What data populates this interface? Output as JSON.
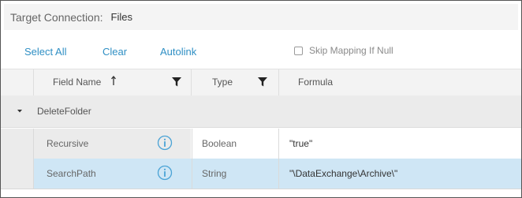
{
  "header": {
    "label": "Target Connection:",
    "value": "Files"
  },
  "toolbar": {
    "select_all": "Select All",
    "clear": "Clear",
    "autolink": "Autolink",
    "skip_mapping_label": "Skip Mapping If Null",
    "skip_mapping_checked": false
  },
  "columns": {
    "field_name": "Field Name",
    "type": "Type",
    "formula": "Formula"
  },
  "group": {
    "label": "DeleteFolder",
    "expanded": true
  },
  "rows": [
    {
      "field": "Recursive",
      "type": "Boolean",
      "formula": "\"true\"",
      "selected": false
    },
    {
      "field": "SearchPath",
      "type": "String",
      "formula": "\"\\DataExchange\\Archive\\\"",
      "selected": true
    }
  ],
  "colors": {
    "accent": "#2f8fc4",
    "selected_row": "#cfe6f5",
    "info_icon": "#4aa3d6"
  },
  "icons": {
    "sort": "sort-ascending-arrow-icon",
    "filter": "filter-funnel-icon",
    "caret": "caret-down-icon",
    "info": "info-circle-icon"
  }
}
